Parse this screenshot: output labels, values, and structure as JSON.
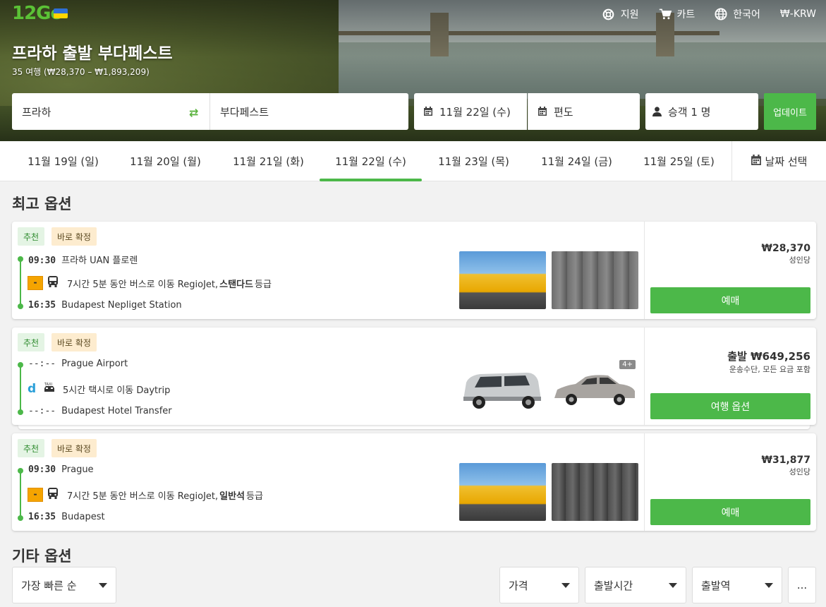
{
  "brand": {
    "logo_text": "12Go",
    "accent": "#4cb849",
    "flag": "Ukraine"
  },
  "topnav": [
    {
      "label": "지원",
      "icon": "lifebuoy-icon"
    },
    {
      "label": "카트",
      "icon": "cart-icon"
    },
    {
      "label": "한국어",
      "icon": "globe-icon"
    },
    {
      "label": "₩-KRW",
      "icon": ""
    }
  ],
  "route": {
    "title": "프라하 출발 부다페스트",
    "subtitle": "35 여행 (₩28,370 – ₩1,893,209)"
  },
  "search": {
    "from": "프라하",
    "to": "부다페스트",
    "date": "11월 22일 (수)",
    "return": "편도",
    "passengers": "승객 1 명",
    "update_label": "업데이트"
  },
  "dates": {
    "tabs": [
      "11월 19일 (일)",
      "11월 20일 (월)",
      "11월 21일 (화)",
      "11월 22일 (수)",
      "11월 23일 (목)",
      "11월 24일 (금)",
      "11월 25일 (토)"
    ],
    "active_index": 3,
    "select_label": "날짜 선택"
  },
  "best_title": "최고 옵션",
  "other_title": "기타 옵션",
  "results": [
    {
      "badges": {
        "recommended": "추천",
        "instant": "바로 확정"
      },
      "dep_time": "09:30",
      "dep_station": "프라하 UAN 플로렌",
      "segment_pre": "7시간 5분 동안 버스로 이동 RegioJet,",
      "segment_class": "스탠다드",
      "segment_post": "등급",
      "arr_time": "16:35",
      "arr_station": "Budapest Nepliget Station",
      "price": "₩28,370",
      "price_note": "성인당",
      "button": "예매"
    },
    {
      "badges": {
        "recommended": "추천",
        "instant": "바로 확정"
      },
      "dep_time": "--:--",
      "dep_station": "Prague Airport",
      "segment_pre": "5시간 택시로 이동 Daytrip",
      "segment_class": "",
      "segment_post": "",
      "arr_time": "--:--",
      "arr_station": "Budapest Hotel Transfer",
      "price": "출발 ₩649,256",
      "price_note": "운송수단, 모든 요금 포함",
      "button": "여행 옵션",
      "more_count": "4+"
    },
    {
      "badges": {
        "recommended": "추천",
        "instant": "바로 확정"
      },
      "dep_time": "09:30",
      "dep_station": "Prague",
      "segment_pre": "7시간 5분 동안 버스로 이동 RegioJet,",
      "segment_class": "일반석",
      "segment_post": "등급",
      "arr_time": "16:35",
      "arr_station": "Budapest",
      "price": "₩31,877",
      "price_note": "성인당",
      "button": "예매"
    }
  ],
  "filters": {
    "sort": "가장 빠른 순",
    "price": "가격",
    "departure_time": "출발시간",
    "departure_station": "출발역",
    "more": "..."
  }
}
